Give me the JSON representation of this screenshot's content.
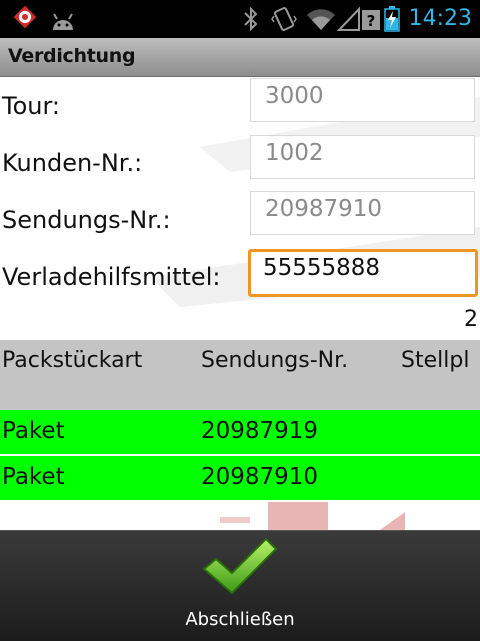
{
  "status_bar": {
    "time": "14:23",
    "icons": [
      "app-alert-icon",
      "android-debug-icon",
      "bluetooth-icon",
      "vibrate-icon",
      "wifi-icon",
      "signal-icon",
      "battery-charging-icon"
    ],
    "accent_color": "#33b5e5"
  },
  "title_bar": {
    "title": "Verdichtung"
  },
  "form": {
    "tour_label": "Tour:",
    "tour_value": "3000",
    "customer_label": "Kunden-Nr.:",
    "customer_value": "1002",
    "shipment_label": "Sendungs-Nr.:",
    "shipment_value": "20987910",
    "loading_aid_label": "Verladehilfsmittel:",
    "loading_aid_value": "55555888",
    "active_border_color": "#f09522"
  },
  "list": {
    "count": "2",
    "columns": [
      "Packstückart",
      "Sendungs-Nr.",
      "Stellpl"
    ],
    "rows": [
      {
        "type": "Paket",
        "shipment": "20987919"
      },
      {
        "type": "Paket",
        "shipment": "20987910"
      }
    ],
    "row_color": "#00ff00"
  },
  "bottom_bar": {
    "finish_label": "Abschließen",
    "icon": "checkmark-icon"
  }
}
